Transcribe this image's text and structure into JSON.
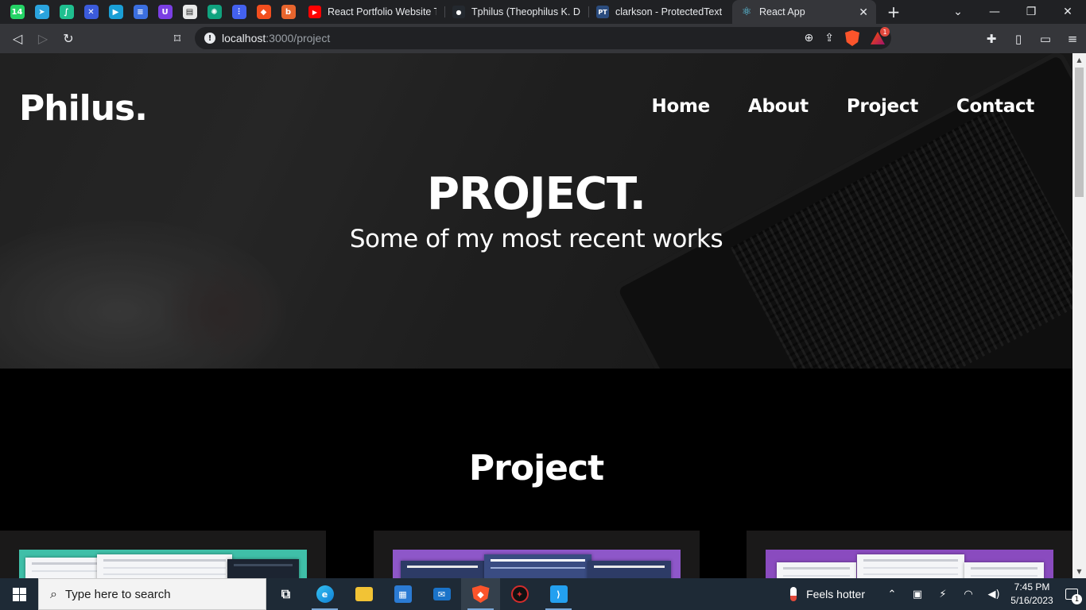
{
  "browser": {
    "pinned_tabs": [
      {
        "icon": "whatsapp-icon",
        "glyph": "14",
        "color": "#25d366"
      },
      {
        "icon": "telegram-icon",
        "glyph": "➤",
        "color": "#2aa3de"
      },
      {
        "icon": "feather-app-icon",
        "glyph": "∫",
        "color": "#1fbf8f"
      },
      {
        "icon": "tool-app-icon",
        "glyph": "✕",
        "color": "#3b5bdb"
      },
      {
        "icon": "play-app-icon",
        "glyph": "▶",
        "color": "#1a9fd6"
      },
      {
        "icon": "docs-icon",
        "glyph": "≡",
        "color": "#3b6fe0"
      },
      {
        "icon": "u-app-icon",
        "glyph": "U",
        "color": "#7b3fe4"
      },
      {
        "icon": "page-app-icon",
        "glyph": "▤",
        "color": "#e9e9e9"
      },
      {
        "icon": "chatgpt-icon",
        "glyph": "✺",
        "color": "#10a37f"
      },
      {
        "icon": "analytics-icon",
        "glyph": "⫶",
        "color": "#4361ee"
      },
      {
        "icon": "figma-icon",
        "glyph": "◆",
        "color": "#f24e1e"
      },
      {
        "icon": "b-app-icon",
        "glyph": "b",
        "color": "#e8652d"
      }
    ],
    "tabs": [
      {
        "title": "React Portfolio Website Tut",
        "icon": "youtube-icon",
        "glyph": "▶",
        "color": "#ff0000",
        "active": false
      },
      {
        "title": "Tphilus (Theophilus K. Dadz",
        "icon": "github-icon",
        "glyph": "●",
        "color": "#24292f",
        "active": false
      },
      {
        "title": "clarkson - ProtectedText",
        "icon": "protectedtext-icon",
        "glyph": "PT",
        "color": "#2b4c7e",
        "active": false
      },
      {
        "title": "React App",
        "icon": "react-icon",
        "glyph": "⚛",
        "color": "#35363a",
        "active": true
      }
    ],
    "url_host": "localhost",
    "url_path": ":3000/project",
    "rewards_badge": "1"
  },
  "site": {
    "logo": "Philus.",
    "nav": [
      "Home",
      "About",
      "Project",
      "Contact"
    ],
    "hero_title": "PROJECT.",
    "hero_subtitle": "Some of my most recent works",
    "section_title": "Project"
  },
  "projects": [
    {
      "thumb_color": "#3fbfa8"
    },
    {
      "thumb_color": "#8e57c9"
    },
    {
      "thumb_color": "#8a4bbf"
    }
  ],
  "taskbar": {
    "search_placeholder": "Type here to search",
    "weather": "Feels hotter",
    "time": "7:45 PM",
    "date": "5/16/2023",
    "notification_count": "1"
  }
}
